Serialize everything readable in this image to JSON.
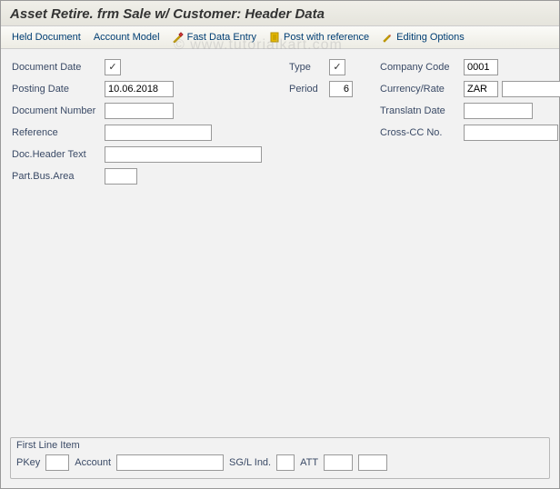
{
  "title": "Asset Retire. frm Sale w/ Customer: Header Data",
  "toolbar": {
    "held_document": "Held Document",
    "account_model": "Account Model",
    "fast_data_entry": "Fast Data Entry",
    "post_with_reference": "Post with reference",
    "editing_options": "Editing Options"
  },
  "fields": {
    "document_date": {
      "label": "Document Date",
      "value": "",
      "checked": true
    },
    "posting_date": {
      "label": "Posting Date",
      "value": "10.06.2018"
    },
    "document_number": {
      "label": "Document Number",
      "value": ""
    },
    "reference": {
      "label": "Reference",
      "value": ""
    },
    "doc_header_text": {
      "label": "Doc.Header Text",
      "value": ""
    },
    "part_bus_area": {
      "label": "Part.Bus.Area",
      "value": ""
    },
    "type": {
      "label": "Type",
      "value": "",
      "checked": true
    },
    "period": {
      "label": "Period",
      "value": "6"
    },
    "company_code": {
      "label": "Company Code",
      "value": "0001"
    },
    "currency_rate": {
      "label": "Currency/Rate",
      "value": "ZAR",
      "value2": ""
    },
    "translatn_date": {
      "label": "Translatn Date",
      "value": ""
    },
    "cross_cc_no": {
      "label": "Cross-CC No.",
      "value": ""
    }
  },
  "groupbox": {
    "title": "First Line Item",
    "pkey": {
      "label": "PKey",
      "value": ""
    },
    "account": {
      "label": "Account",
      "value": ""
    },
    "sgl_ind": {
      "label": "SG/L Ind.",
      "value": ""
    },
    "att": {
      "label": "ATT",
      "value": ""
    },
    "extra": {
      "value": ""
    }
  },
  "watermark": "© www.tutorialkart.com"
}
